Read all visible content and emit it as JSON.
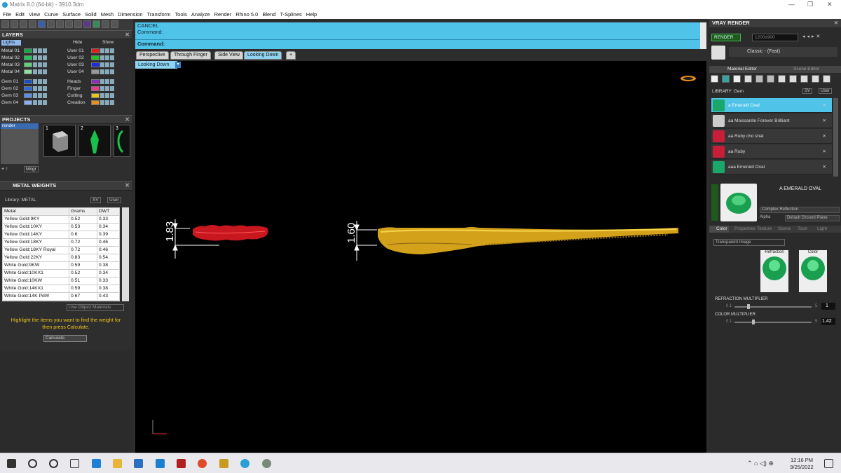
{
  "window": {
    "title": "Matrix 8.0 (64-bit) - 3910.3dm",
    "min": "—",
    "max": "❐",
    "close": "✕"
  },
  "menu": [
    "File",
    "Edit",
    "View",
    "Curve",
    "Surface",
    "Solid",
    "Mesh",
    "Dimension",
    "Transform",
    "Tools",
    "Analyze",
    "Render",
    "Rhino 5.0",
    "Blend",
    "T-Splines",
    "Help"
  ],
  "layers": {
    "title": "LAYERS",
    "lights": "Lights",
    "hide": "Hide",
    "show": "Show",
    "left": [
      {
        "name": "Metal 01",
        "color": "#1aa34a"
      },
      {
        "name": "Metal 02",
        "color": "#27c35a"
      },
      {
        "name": "Metal 03",
        "color": "#5fd17a"
      },
      {
        "name": "Metal 04",
        "color": "#8fe09f"
      },
      {
        "name": "Gem 01",
        "color": "#1a4fbf"
      },
      {
        "name": "Gem 02",
        "color": "#2f68d8"
      },
      {
        "name": "Gem 03",
        "color": "#5b8ee8"
      },
      {
        "name": "Gem 04",
        "color": "#88b0f0"
      }
    ],
    "right": [
      {
        "name": "User 01",
        "color": "#e21b1b"
      },
      {
        "name": "User 02",
        "color": "#1fbf2b"
      },
      {
        "name": "User 03",
        "color": "#1a2be0"
      },
      {
        "name": "User 04",
        "color": "#999999"
      },
      {
        "name": "Heads",
        "color": "#8c2fb8"
      },
      {
        "name": "Finger",
        "color": "#e83d8f"
      },
      {
        "name": "Cutting",
        "color": "#e8c51f"
      },
      {
        "name": "Creation",
        "color": "#e8901f"
      }
    ]
  },
  "projects": {
    "title": "PROJECTS",
    "item": "render",
    "thumbs": [
      "1",
      "2",
      "3"
    ],
    "mngr": "Mngr"
  },
  "metal_weights": {
    "title": "METAL WEIGHTS",
    "library_label": "Library: METAL",
    "btn1": "SV",
    "btn2": "User",
    "columns": [
      "Metal",
      "Grams",
      "DWT"
    ],
    "rows": [
      [
        "Yellow Gold:9KY",
        "0.52",
        "0.33"
      ],
      [
        "Yellow Gold:10KY",
        "0.53",
        "0.34"
      ],
      [
        "Yellow Gold:14KY",
        "0.6",
        "0.39"
      ],
      [
        "Yellow Gold:18KY",
        "0.72",
        "0.46"
      ],
      [
        "Yellow Gold:18KY Royal",
        "0.72",
        "0.46"
      ],
      [
        "Yellow Gold:22KY",
        "0.83",
        "0.54"
      ],
      [
        "White Gold:9KW",
        "0.59",
        "0.38"
      ],
      [
        "White Gold:10KX1",
        "0.52",
        "0.34"
      ],
      [
        "White Gold:10KW",
        "0.51",
        "0.33"
      ],
      [
        "White Gold:14KX1",
        "0.59",
        "0.38"
      ],
      [
        "White Gold:14K PdW",
        "0.67",
        "0.43"
      ]
    ],
    "use_object": "Use Object Materials",
    "hint": "Highlight the items you want to find the weight for then press Calculate.",
    "calculate": "Calculate"
  },
  "command": {
    "line1": "CANCEL",
    "line2": "Command:",
    "prompt": "Command:"
  },
  "viewport": {
    "tabs": [
      "Perspective",
      "Through Finger",
      "Side View",
      "Looking Down",
      "+"
    ],
    "active_label": "Looking Down",
    "dim1": "1.83",
    "dim2": "1.60"
  },
  "vray": {
    "title": "VRAY RENDER",
    "render_btn": "RENDER",
    "resolution": "1200x900",
    "preset_label": "Classic - (Fast)",
    "tab1": "Material Editor",
    "tab2": "Scene Editor",
    "library": "LIBRARY: Gem",
    "materials": [
      {
        "name": "a Emerald Oval",
        "color": "#1aa86a"
      },
      {
        "name": "aa Moissanite Forever Brilliant",
        "color": "#cccccc"
      },
      {
        "name": "aa Ruby cho shat",
        "color": "#c81e3a"
      },
      {
        "name": "aa Ruby",
        "color": "#c81e3a"
      },
      {
        "name": "aaa Emerald Oval",
        "color": "#1aa86a"
      }
    ],
    "selected_name": "A EMERALD OVAL",
    "reflection": "Complex Reflection",
    "alpha": "Alpha",
    "ground": "Default Ground Plane",
    "subtabs": [
      "Color",
      "Properties",
      "Texture",
      "Scene",
      "Toon",
      "Light"
    ],
    "transparent": "Transparent Image",
    "refraction_label": "Refraction",
    "color_label": "Color",
    "refr_mult_label": "REFRACTION MULTIPLIER",
    "refr_min": "0.1",
    "refr_max": "5",
    "refr_value": "1",
    "color_mult_label": "COLOR MULTIPLIER",
    "col_min": "0.1",
    "col_max": "5",
    "col_value": "1.42"
  },
  "taskbar": {
    "time": "12:16 PM",
    "date": "9/25/2022"
  }
}
